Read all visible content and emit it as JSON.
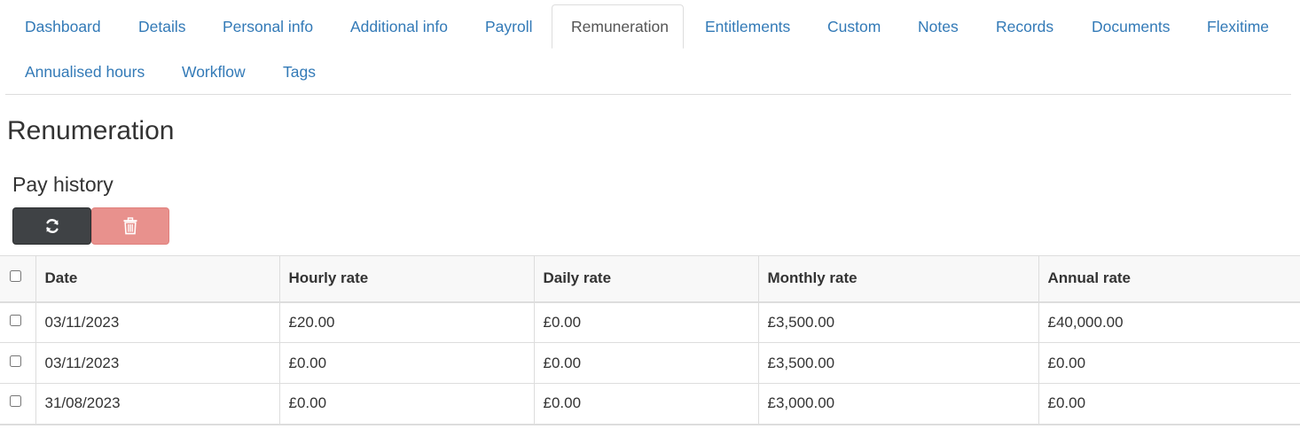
{
  "tabs": [
    {
      "label": "Dashboard"
    },
    {
      "label": "Details"
    },
    {
      "label": "Personal info"
    },
    {
      "label": "Additional info"
    },
    {
      "label": "Payroll"
    },
    {
      "label": "Remuneration",
      "active": true
    },
    {
      "label": "Entitlements"
    },
    {
      "label": "Custom"
    },
    {
      "label": "Notes"
    },
    {
      "label": "Records"
    },
    {
      "label": "Documents"
    },
    {
      "label": "Flexitime"
    },
    {
      "label": "Annualised hours"
    },
    {
      "label": "Workflow"
    },
    {
      "label": "Tags"
    }
  ],
  "page": {
    "title": "Renumeration",
    "section_title": "Pay history"
  },
  "toolbar": {
    "refresh_icon": "refresh-icon",
    "delete_icon": "trash-icon"
  },
  "table": {
    "headers": [
      "Date",
      "Hourly rate",
      "Daily rate",
      "Monthly rate",
      "Annual rate"
    ],
    "rows": [
      [
        "03/11/2023",
        "£20.00",
        "£0.00",
        "£3,500.00",
        "£40,000.00"
      ],
      [
        "03/11/2023",
        "£0.00",
        "£0.00",
        "£3,500.00",
        "£0.00"
      ],
      [
        "31/08/2023",
        "£0.00",
        "£0.00",
        "£3,000.00",
        "£0.00"
      ]
    ]
  },
  "colors": {
    "link": "#337ab7",
    "active_tab_text": "#555555",
    "refresh_button": "#3f4245",
    "delete_button": "#e8918d",
    "header_background": "#f8f8f8"
  }
}
